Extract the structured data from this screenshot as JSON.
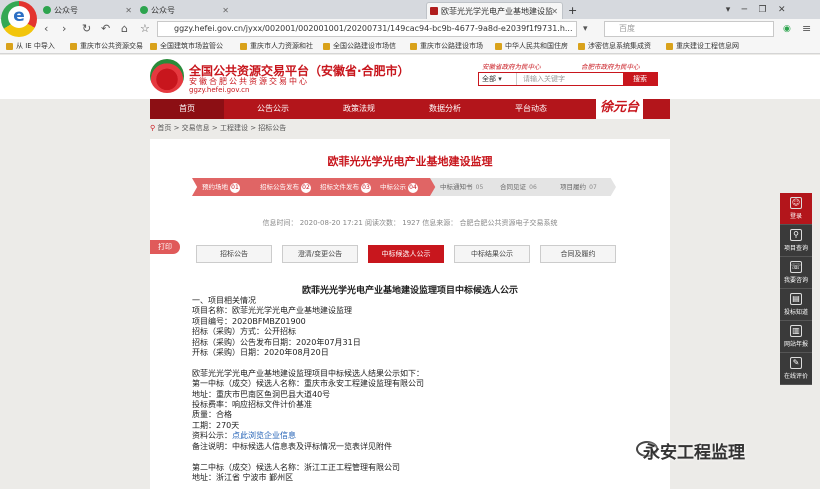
{
  "browser": {
    "tabs": [
      {
        "label": "公众号",
        "active": false
      },
      {
        "label": "公众号",
        "active": false
      },
      {
        "label": "欧菲光光学光电产业基地建设监",
        "active": true
      }
    ],
    "new_tab": "+",
    "address": "ggzy.hefei.gov.cn/jyxx/002001/002001001/20200731/149cac94-bc9b-4677-9a8d-e2039f1f9731.h...",
    "search_placeholder": "百度",
    "bookmarks": [
      "从 IE 中导入",
      "重庆市公共资源交易",
      "全国建筑市场监管公",
      "重庆市人力资源和社",
      "全国公路建设市场信",
      "重庆市公路建设市场",
      "中华人民共和国住房",
      "涉密信息系统集成资",
      "重庆建设工程信息网"
    ]
  },
  "site": {
    "title": "全国公共资源交易平台（安徽省·合肥市）",
    "subtitle": "安徽合肥公共资源交易中心",
    "domain": "ggzy.hefei.gov.cn",
    "slogan_left": "安徽省政府为民中心",
    "slogan_right": "合肥市政府为民中心",
    "search_scope": "全部",
    "search_placeholder": "请输入关键字",
    "search_button": "搜索",
    "nav": [
      "首页",
      "公告公示",
      "政策法规",
      "数据分析",
      "平台动态"
    ],
    "brandmark": "徐元台",
    "breadcrumb": "首页 > 交易信息 > 工程建设 > 招标公告"
  },
  "article": {
    "title": "欧菲光光学光电产业基地建设监理",
    "steps": [
      {
        "label": "预约场地",
        "num": "01",
        "done": true
      },
      {
        "label": "招标公告发布",
        "num": "02",
        "done": true
      },
      {
        "label": "招标文件发布",
        "num": "03",
        "done": true
      },
      {
        "label": "中标公示",
        "num": "04",
        "done": true
      },
      {
        "label": "中标通知书",
        "num": "05",
        "done": false
      },
      {
        "label": "合同见证",
        "num": "06",
        "done": false
      },
      {
        "label": "项目履约",
        "num": "07",
        "done": false
      }
    ],
    "meta": "信息时间：  2020-08-20 17:21    阅读次数：  1927    信息来源：  合肥合肥公共资源电子交易系统",
    "print": "打印",
    "subtabs": [
      "招标公告",
      "澄清/变更公告",
      "中标候选人公示",
      "中标结果公示",
      "合同及履约"
    ],
    "doc_title": "欧菲光光学光电产业基地建设监理项目中标候选人公示",
    "lines": [
      "一、项目相关情况",
      "项目名称：欧菲光光学光电产业基地建设监理",
      "项目编号：2020BFMBZ01900",
      "招标（采购）方式：公开招标",
      "招标（采购）公告发布日期：2020年07月31日",
      "开标（采购）日期：2020年08月20日",
      "",
      "欧菲光光学光电产业基地建设监理项目中标候选人结果公示如下：",
      "第一中标（成交）候选人名称：重庆市永安工程建设监理有限公司",
      "地址：重庆市巴南区鱼洞巴县大道40号",
      "投标费率：响应招标文件计价基准",
      "质量：合格",
      "工期：270天"
    ],
    "credit_label": "资料公示：",
    "credit_link": "点此浏览企业信息",
    "lines2": [
      "备注说明：中标候选人信息表及评标情况一览表详见附件",
      "",
      "第二中标（成交）候选人名称：浙江工正工程管理有限公司",
      "地址：浙江省 宁波市 鄞州区"
    ]
  },
  "sidebar": [
    "登录",
    "项目查询",
    "我要咨询",
    "投标知道",
    "网站年报",
    "在线评价"
  ],
  "watermark": "永安工程监理"
}
